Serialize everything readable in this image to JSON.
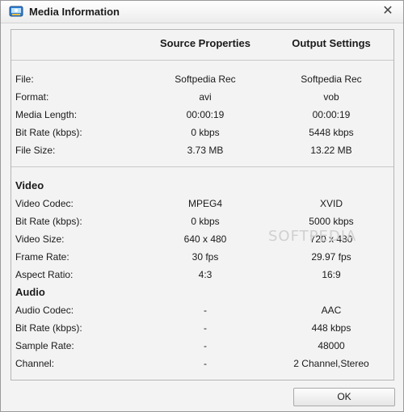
{
  "window": {
    "title": "Media Information",
    "close_glyph": "✕"
  },
  "columns": {
    "source": "Source Properties",
    "output": "Output Settings"
  },
  "general": [
    {
      "label": "File:",
      "source": "Softpedia Rec",
      "output": "Softpedia Rec"
    },
    {
      "label": "Format:",
      "source": "avi",
      "output": "vob"
    },
    {
      "label": "Media Length:",
      "source": "00:00:19",
      "output": "00:00:19"
    },
    {
      "label": "Bit Rate (kbps):",
      "source": "0 kbps",
      "output": "5448 kbps"
    },
    {
      "label": "File Size:",
      "source": "3.73 MB",
      "output": "13.22 MB"
    }
  ],
  "video": {
    "heading": "Video",
    "rows": [
      {
        "label": "Video Codec:",
        "source": "MPEG4",
        "output": "XVID"
      },
      {
        "label": "Bit Rate (kbps):",
        "source": "0 kbps",
        "output": "5000 kbps"
      },
      {
        "label": "Video Size:",
        "source": "640 x 480",
        "output": "720 x 480"
      },
      {
        "label": "Frame Rate:",
        "source": "30 fps",
        "output": "29.97 fps"
      },
      {
        "label": "Aspect Ratio:",
        "source": "4:3",
        "output": "16:9"
      }
    ]
  },
  "audio": {
    "heading": "Audio",
    "rows": [
      {
        "label": "Audio Codec:",
        "source": "-",
        "output": "AAC"
      },
      {
        "label": "Bit Rate (kbps):",
        "source": "-",
        "output": "448 kbps"
      },
      {
        "label": "Sample Rate:",
        "source": "-",
        "output": "48000"
      },
      {
        "label": "Channel:",
        "source": "-",
        "output": "2 Channel,Stereo"
      }
    ]
  },
  "buttons": {
    "ok": "OK"
  },
  "watermark": "SOFTPEDIA",
  "icons": {
    "app": "media-app-icon",
    "close": "close-icon"
  }
}
